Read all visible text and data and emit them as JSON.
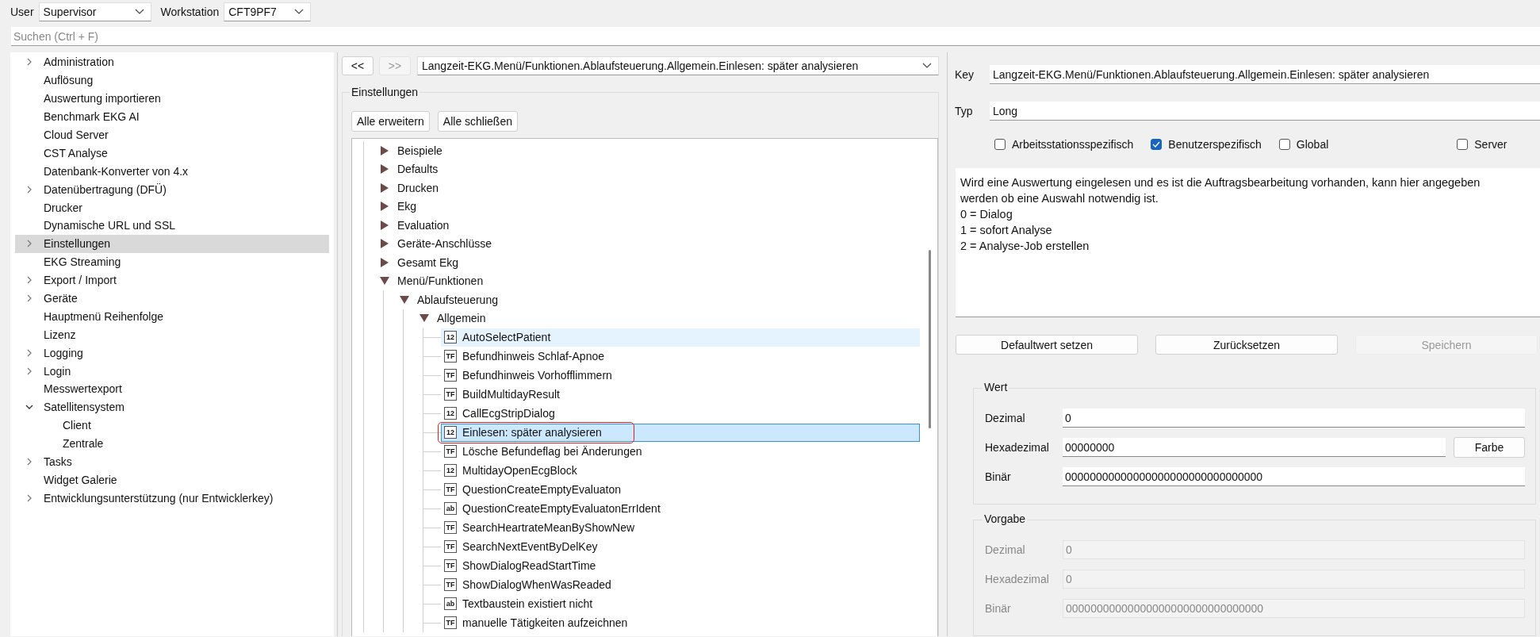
{
  "toolbar": {
    "user_label": "User",
    "user_value": "Supervisor",
    "workstation_label": "Workstation",
    "workstation_value": "CFT9PF7"
  },
  "search": {
    "placeholder": "Suchen (Ctrl + F)"
  },
  "sidebar": {
    "items": [
      {
        "label": "Administration",
        "expanded": false,
        "selected": false
      },
      {
        "label": "Auflösung",
        "selected": false
      },
      {
        "label": "Auswertung importieren",
        "selected": false
      },
      {
        "label": "Benchmark EKG AI",
        "selected": false
      },
      {
        "label": "Cloud Server",
        "selected": false
      },
      {
        "label": "CST Analyse",
        "selected": false
      },
      {
        "label": "Datenbank-Konverter von 4.x",
        "selected": false
      },
      {
        "label": "Datenübertragung (DFÜ)",
        "expanded": false,
        "selected": false
      },
      {
        "label": "Drucker",
        "selected": false
      },
      {
        "label": "Dynamische URL und SSL",
        "selected": false
      },
      {
        "label": "Einstellungen",
        "expanded": false,
        "selected": true
      },
      {
        "label": "EKG Streaming",
        "selected": false
      },
      {
        "label": "Export / Import",
        "expanded": false,
        "selected": false
      },
      {
        "label": "Geräte",
        "expanded": false,
        "selected": false
      },
      {
        "label": "Hauptmenü Reihenfolge",
        "selected": false
      },
      {
        "label": "Lizenz",
        "selected": false
      },
      {
        "label": "Logging",
        "expanded": false,
        "selected": false
      },
      {
        "label": "Login",
        "expanded": false,
        "selected": false
      },
      {
        "label": "Messwertexport",
        "selected": false
      },
      {
        "label": "Satellitensystem",
        "expanded": true,
        "selected": false,
        "children": [
          {
            "label": "Client",
            "selected": false
          },
          {
            "label": "Zentrale",
            "selected": false
          }
        ]
      },
      {
        "label": "Tasks",
        "expanded": false,
        "selected": false
      },
      {
        "label": "Widget Galerie",
        "selected": false
      },
      {
        "label": "Entwicklungsunterstützung (nur Entwicklerkey)",
        "expanded": false,
        "selected": false
      }
    ]
  },
  "navigator": {
    "back": {
      "label": "<<",
      "disabled": false
    },
    "forward": {
      "label": ">>",
      "disabled": true
    },
    "path": "Langzeit-EKG.Menü/Funktionen.Ablaufsteuerung.Allgemein.Einlesen: später analysieren"
  },
  "settings_group": {
    "title": "Einstellungen",
    "buttons": [
      "Alle erweitern",
      "Alle schließen"
    ],
    "tree": [
      {
        "label": "Beispiele",
        "expanded": false
      },
      {
        "label": "Defaults",
        "expanded": false
      },
      {
        "label": "Drucken",
        "expanded": false
      },
      {
        "label": "Ekg",
        "expanded": false
      },
      {
        "label": "Evaluation",
        "expanded": false
      },
      {
        "label": "Geräte-Anschlüsse",
        "expanded": false
      },
      {
        "label": "Gesamt Ekg",
        "expanded": false
      },
      {
        "label": "Menü/Funktionen",
        "expanded": true,
        "children": [
          {
            "label": "Ablaufsteuerung",
            "expanded": true,
            "children": [
              {
                "label": "Allgemein",
                "expanded": true,
                "children": [
                  {
                    "label": "AutoSelectPatient",
                    "badge": "12",
                    "selected": false,
                    "hovered": true,
                    "annotated": false
                  },
                  {
                    "label": "Befundhinweis Schlaf-Apnoe",
                    "badge": "TF",
                    "selected": false,
                    "hovered": false,
                    "annotated": false
                  },
                  {
                    "label": "Befundhinweis Vorhofflimmern",
                    "badge": "TF",
                    "selected": false,
                    "hovered": false,
                    "annotated": false
                  },
                  {
                    "label": "BuildMultidayResult",
                    "badge": "TF",
                    "selected": false,
                    "hovered": false,
                    "annotated": false
                  },
                  {
                    "label": "CallEcgStripDialog",
                    "badge": "12",
                    "selected": false,
                    "hovered": false,
                    "annotated": false
                  },
                  {
                    "label": "Einlesen: später analysieren",
                    "badge": "12",
                    "selected": true,
                    "hovered": false,
                    "annotated": true
                  },
                  {
                    "label": "Lösche Befundeflag bei Änderungen",
                    "badge": "TF",
                    "selected": false,
                    "hovered": false,
                    "annotated": false
                  },
                  {
                    "label": "MultidayOpenEcgBlock",
                    "badge": "12",
                    "selected": false,
                    "hovered": false,
                    "annotated": false
                  },
                  {
                    "label": "QuestionCreateEmptyEvaluaton",
                    "badge": "TF",
                    "selected": false,
                    "hovered": false,
                    "annotated": false
                  },
                  {
                    "label": "QuestionCreateEmptyEvaluatonErrIdent",
                    "badge": "ab",
                    "selected": false,
                    "hovered": false,
                    "annotated": false
                  },
                  {
                    "label": "SearchHeartrateMeanByShowNew",
                    "badge": "TF",
                    "selected": false,
                    "hovered": false,
                    "annotated": false
                  },
                  {
                    "label": "SearchNextEventByDelKey",
                    "badge": "TF",
                    "selected": false,
                    "hovered": false,
                    "annotated": false
                  },
                  {
                    "label": "ShowDialogReadStartTime",
                    "badge": "TF",
                    "selected": false,
                    "hovered": false,
                    "annotated": false
                  },
                  {
                    "label": "ShowDialogWhenWasReaded",
                    "badge": "TF",
                    "selected": false,
                    "hovered": false,
                    "annotated": false
                  },
                  {
                    "label": "Textbaustein existiert nicht",
                    "badge": "ab",
                    "selected": false,
                    "hovered": false,
                    "annotated": false
                  },
                  {
                    "label": "manuelle Tätigkeiten aufzeichnen",
                    "badge": "TF",
                    "selected": false,
                    "hovered": false,
                    "annotated": false
                  }
                ]
              }
            ]
          }
        ]
      }
    ]
  },
  "details": {
    "key_label": "Key",
    "key_value": "Langzeit-EKG.Menü/Funktionen.Ablaufsteuerung.Allgemein.Einlesen: später analysieren",
    "type_label": "Typ",
    "type_value": "Long",
    "flags": [
      {
        "label": "Arbeitsstationsspezifisch",
        "checked": false
      },
      {
        "label": "Benutzerspezifisch",
        "checked": true
      },
      {
        "label": "Global",
        "checked": false
      },
      {
        "label": "Server",
        "checked": false
      }
    ],
    "description": [
      "Wird eine Auswertung eingelesen und es ist die Auftragsbearbeitung vorhanden, kann hier angegeben werden ob eine Auswahl notwendig ist.",
      "0 = Dialog",
      "1 = sofort Analyse",
      "2 = Analyse-Job erstellen"
    ],
    "buttons": [
      {
        "label": "Defaultwert setzen",
        "disabled": false
      },
      {
        "label": "Zurücksetzen",
        "disabled": false
      },
      {
        "label": "Speichern",
        "disabled": true
      }
    ],
    "groups": [
      {
        "title": "Wert",
        "disabled": false,
        "fields": [
          {
            "label": "Dezimal",
            "value": "0"
          },
          {
            "label": "Hexadezimal",
            "value": "00000000",
            "button": "Farbe"
          },
          {
            "label": "Binär",
            "value": "00000000000000000000000000000000"
          }
        ]
      },
      {
        "title": "Vorgabe",
        "disabled": true,
        "fields": [
          {
            "label": "Dezimal",
            "value": "0"
          },
          {
            "label": "Hexadezimal",
            "value": "0"
          },
          {
            "label": "Binär",
            "value": "00000000000000000000000000000000"
          }
        ]
      }
    ]
  }
}
